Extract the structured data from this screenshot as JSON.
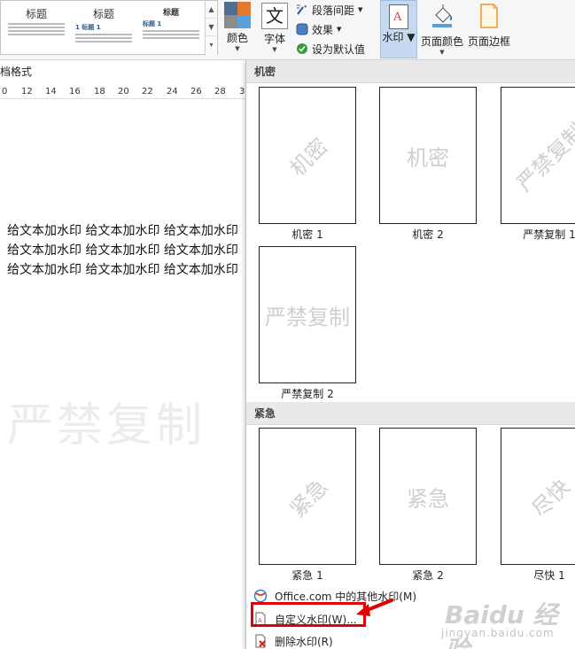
{
  "ribbon": {
    "styles_gallery": [
      {
        "title": "标题"
      },
      {
        "title": "标题",
        "heading": "1 标题 1"
      },
      {
        "title": "标题",
        "heading": "标题 1"
      }
    ],
    "colors_label": "颜色",
    "fonts_label": "字体",
    "font_icon_glyph": "文",
    "paragraph_spacing_label": "段落间距",
    "effects_label": "效果",
    "set_default_label": "设为默认值",
    "watermark_label": "水印",
    "page_color_label": "页面颜色",
    "page_border_label": "页面边框"
  },
  "document": {
    "format_label": "档格式",
    "ruler_ticks": [
      "0",
      "12",
      "14",
      "16",
      "18",
      "20",
      "22",
      "24",
      "26",
      "28",
      "3"
    ],
    "lines": [
      "给文本加水印 给文本加水印 给文本加水印",
      "给文本加水印 给文本加水印 给文本加水印",
      "给文本加水印 给文本加水印 给文本加水印"
    ],
    "watermark_text": "严禁复制"
  },
  "panel": {
    "sections": [
      {
        "header": "机密",
        "cards": [
          {
            "caption": "机密 1",
            "text": "机密",
            "diagonal": true
          },
          {
            "caption": "机密 2",
            "text": "机密",
            "diagonal": false
          },
          {
            "caption": "严禁复制 1",
            "text": "严禁复制",
            "diagonal": true
          },
          {
            "caption": "严禁复制 2",
            "text": "严禁复制",
            "diagonal": false
          }
        ]
      },
      {
        "header": "紧急",
        "cards": [
          {
            "caption": "紧急 1",
            "text": "紧急",
            "diagonal": true
          },
          {
            "caption": "紧急 2",
            "text": "紧急",
            "diagonal": false
          },
          {
            "caption": "尽快 1",
            "text": "尽快",
            "diagonal": true
          }
        ]
      }
    ],
    "menu": {
      "more_office": "Office.com 中的其他水印(M)",
      "custom": "自定义水印(W)...",
      "remove": "删除水印(R)"
    }
  },
  "overlay": {
    "baidu_logo": "Baidu 经验",
    "baidu_url": "jingyan.baidu.com",
    "highlight_color": "#e00000"
  }
}
